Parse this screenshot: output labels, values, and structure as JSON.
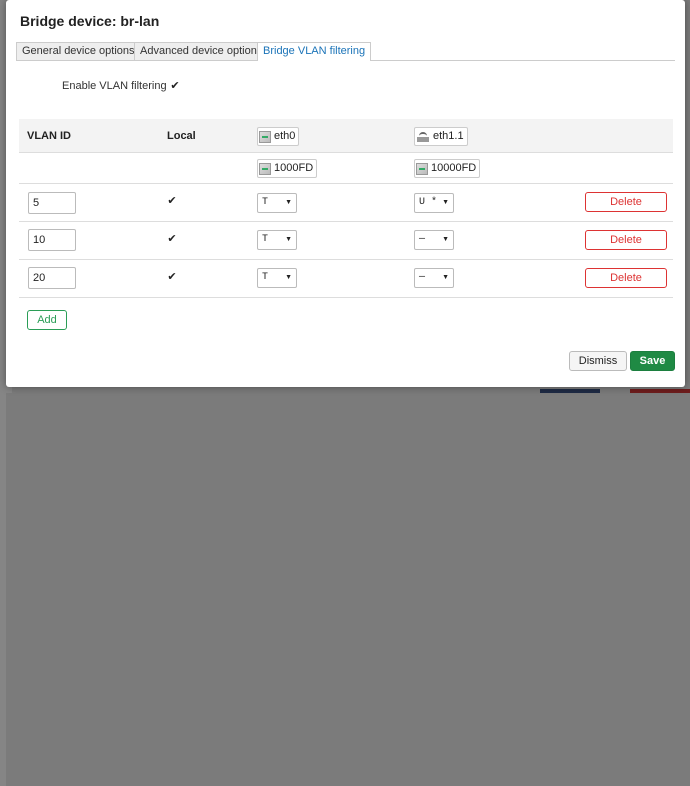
{
  "dialog": {
    "title": "Bridge device: br-lan"
  },
  "tabs": [
    {
      "label": "General device options",
      "active": false
    },
    {
      "label": "Advanced device options",
      "active": false
    },
    {
      "label": "Bridge VLAN filtering",
      "active": true
    }
  ],
  "vlan_filtering": {
    "label": "Enable VLAN filtering",
    "checked": true
  },
  "table": {
    "headers": {
      "vlan_id": "VLAN ID",
      "local": "Local"
    },
    "ports": [
      {
        "name": "eth0",
        "speed": "1000FD",
        "icon": "ethernet-port-icon"
      },
      {
        "name": "eth1.1",
        "speed": "10000FD",
        "icon": "switch-port-icon"
      }
    ],
    "rows": [
      {
        "vlan_id": "5",
        "local": true,
        "eth0": "T",
        "eth1": "U *"
      },
      {
        "vlan_id": "10",
        "local": true,
        "eth0": "T",
        "eth1": "—"
      },
      {
        "vlan_id": "20",
        "local": true,
        "eth0": "T",
        "eth1": "—"
      }
    ],
    "delete_label": "Delete",
    "add_label": "Add"
  },
  "footer": {
    "dismiss_label": "Dismiss",
    "save_label": "Save"
  },
  "colors": {
    "accent": "#1a73b8",
    "danger": "#dd3333",
    "success": "#1f8a44"
  }
}
